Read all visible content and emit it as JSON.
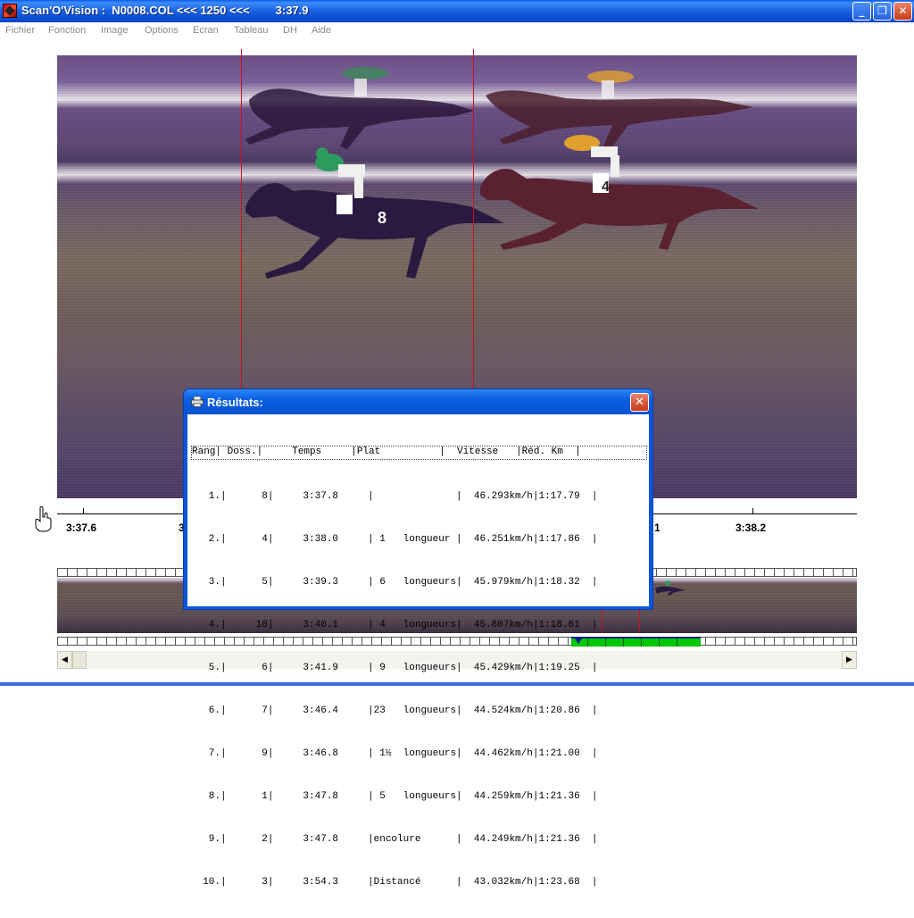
{
  "window": {
    "title": "Scan'O'Vision :  N0008.COL <<< 1250 <<<        3:37.9",
    "minimize": "_",
    "restore": "❐",
    "close": "✕"
  },
  "menu": [
    "Fichier",
    "Fonction",
    "Image",
    "Options",
    "Ecran",
    "Tableau",
    "DH",
    "Aide"
  ],
  "horses": [
    "8",
    "4"
  ],
  "timeline": {
    "labels": [
      "3:37.6",
      "3",
      "1",
      "3:38.2"
    ]
  },
  "dialog": {
    "title": "Résultats:",
    "close": "✕",
    "header": "Rang| Doss.|     Temps     |Plat          |  Vitesse   |Réd. Km  |",
    "rows": [
      "   1.|      8|     3:37.8     |              |  46.293km/h|1:17.79  |",
      "   2.|      4|     3:38.0     | 1   longueur |  46.251km/h|1:17.86  |",
      "   3.|      5|     3:39.3     | 6   longueurs|  45.979km/h|1:18.32  |",
      "   4.|     10|     3:40.1     | 4   longueurs|  45.807km/h|1:18.61  |",
      "   5.|      6|     3:41.9     | 9   longueurs|  45.429km/h|1:19.25  |",
      "   6.|      7|     3:46.4     |23   longueurs|  44.524km/h|1:20.86  |",
      "   7.|      9|     3:46.8     | 1½  longueurs|  44.462km/h|1:21.00  |",
      "   8.|      1|     3:47.8     | 5   longueurs|  44.259km/h|1:21.36  |",
      "   9.|      2|     3:47.8     |encolure      |  44.249km/h|1:21.36  |",
      "  10.|      3|     3:54.3     |Distancé      |  43.032km/h|1:23.68  |"
    ]
  },
  "scrollbar": {
    "left": "◀",
    "right": "▶"
  },
  "colors": {
    "accent": "#0b56dc",
    "finish_line": "#c4131a",
    "progress": "#00c800"
  }
}
